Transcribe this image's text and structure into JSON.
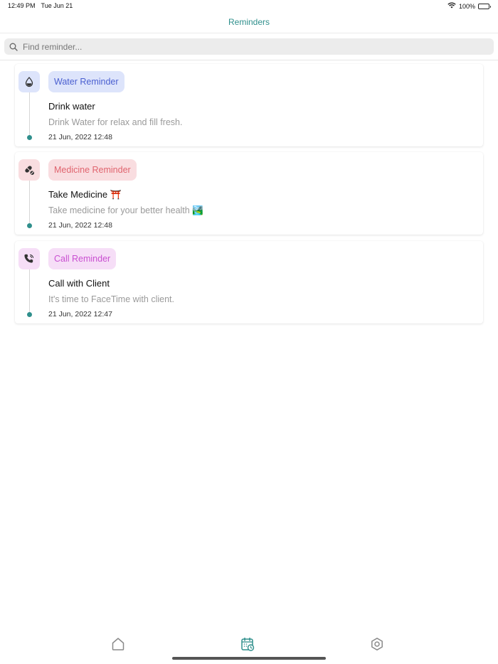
{
  "status": {
    "time": "12:49 PM",
    "date": "Tue Jun 21",
    "battery": "100%"
  },
  "nav": {
    "title": "Reminders"
  },
  "search": {
    "placeholder": "Find reminder..."
  },
  "reminders": [
    {
      "category": "Water Reminder",
      "title": "Drink water",
      "description": "Drink Water for relax and fill fresh.",
      "date": "21 Jun, 2022 12:48",
      "icon": "water-drop-icon",
      "tag_bg": "#dde4fb",
      "tag_color": "#4a5fd0",
      "icon_bg": "#dde4fb"
    },
    {
      "category": "Medicine Reminder",
      "title": "Take Medicine ⛩️",
      "description": "Take medicine for your better health 🏞️",
      "date": "21 Jun, 2022 12:48",
      "icon": "pill-icon",
      "tag_bg": "#f9dde0",
      "tag_color": "#e0646e",
      "icon_bg": "#f9dde0"
    },
    {
      "category": "Call Reminder",
      "title": "Call with Client",
      "description": "It's time to FaceTime with client.",
      "date": "21 Jun, 2022 12:47",
      "icon": "phone-call-icon",
      "tag_bg": "#f6def7",
      "tag_color": "#c94fd1",
      "icon_bg": "#f6def7"
    }
  ],
  "tabs": [
    {
      "name": "home",
      "icon": "home-icon",
      "active": false
    },
    {
      "name": "reminders",
      "icon": "calendar-clock-icon",
      "active": true
    },
    {
      "name": "settings",
      "icon": "settings-hexagon-icon",
      "active": false
    }
  ],
  "colors": {
    "accent": "#2f8f8c",
    "inactive_tab": "#8a8a8a"
  }
}
